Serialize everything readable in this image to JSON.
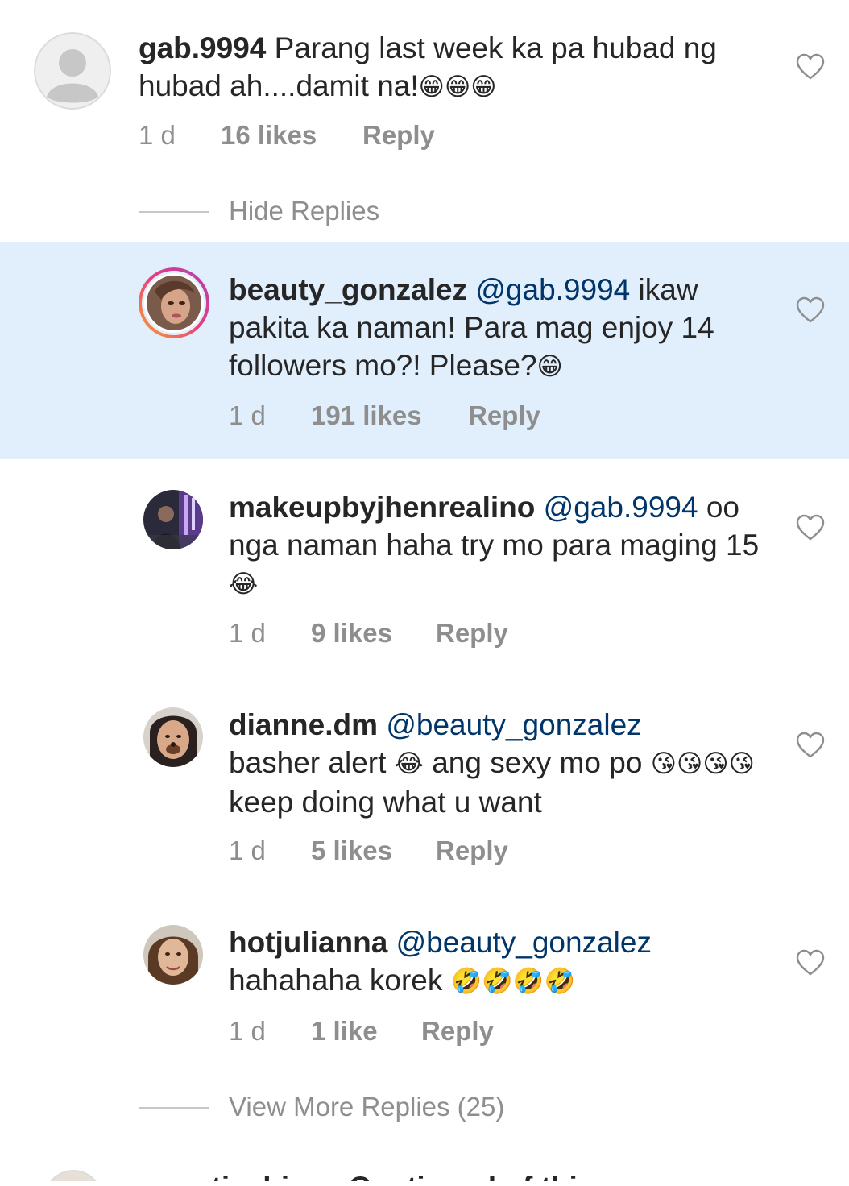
{
  "comments": [
    {
      "username": "gab.9994",
      "mention": "",
      "text": "Parang last week ka pa hubad ng hubad ah....damit na!",
      "emoji": "😁😁😁",
      "time": "1 d",
      "likes": "16 likes",
      "reply": "Reply",
      "avatar": "default-avatar-icon"
    },
    {
      "username": "beauty_gonzalez",
      "mention": "@gab.9994",
      "text": "ikaw pakita ka naman! Para mag enjoy 14 followers mo?! Please?",
      "emoji": "😁",
      "time": "1 d",
      "likes": "191 likes",
      "reply": "Reply",
      "avatar": "profile-photo"
    },
    {
      "username": "makeupbyjhenrealino",
      "mention": "@gab.9994",
      "text": "oo nga naman haha try mo para maging 15",
      "emoji": "😂",
      "time": "1 d",
      "likes": "9 likes",
      "reply": "Reply",
      "avatar": "profile-photo"
    },
    {
      "username": "dianne.dm",
      "mention": "@beauty_gonzalez",
      "text_a": "basher alert",
      "emoji_a": "😂",
      "text_b": "ang sexy mo po",
      "emoji_b": "😘😘😘😘",
      "text_c": "keep doing what u want",
      "time": "1 d",
      "likes": "5 likes",
      "reply": "Reply",
      "avatar": "profile-photo"
    },
    {
      "username": "hotjulianna",
      "mention": "@beauty_gonzalez",
      "text": "hahahaha korek",
      "emoji": "🤣🤣🤣🤣",
      "time": "1 d",
      "likes": "1 like",
      "reply": "Reply",
      "avatar": "profile-photo"
    }
  ],
  "hide_replies": "Hide Replies",
  "view_more_replies": "View More Replies (25)",
  "next_comment_partial": "sweeticahines Continued of thi...",
  "colors": {
    "highlight": "#e1eefb",
    "mention": "#003569",
    "meta": "#8e8e8e",
    "text": "#262626"
  },
  "icons": [
    "heart-icon",
    "default-avatar-icon"
  ]
}
